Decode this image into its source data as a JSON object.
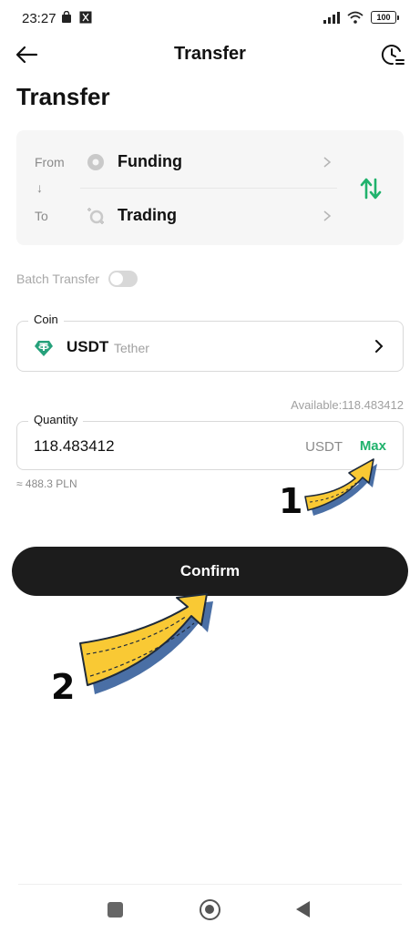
{
  "status_bar": {
    "time": "23:27",
    "battery": "100",
    "icons": [
      "bag-icon",
      "app-notification-icon",
      "signal-icon",
      "wifi-icon",
      "battery-icon"
    ]
  },
  "nav": {
    "title": "Transfer",
    "back_icon": "arrow-left-icon",
    "history_icon": "clock-history-icon"
  },
  "page": {
    "title": "Transfer"
  },
  "transfer": {
    "from_label": "From",
    "from_account": "Funding",
    "to_label": "To",
    "to_account": "Trading",
    "swap_icon": "swap-vertical-icon",
    "accent": "#20b26c"
  },
  "batch": {
    "label": "Batch Transfer",
    "enabled": false
  },
  "coin": {
    "legend": "Coin",
    "symbol": "USDT",
    "name": "Tether",
    "icon_color": "#26a17b"
  },
  "quantity": {
    "available": "Available:118.483412",
    "legend": "Quantity",
    "value": "118.483412",
    "unit": "USDT",
    "max_label": "Max",
    "fiat_approx": "≈ 488.3 PLN"
  },
  "confirm": {
    "label": "Confirm"
  },
  "annotations": {
    "step1": "1",
    "step2": "2",
    "arrow_color": "#f9c934"
  }
}
